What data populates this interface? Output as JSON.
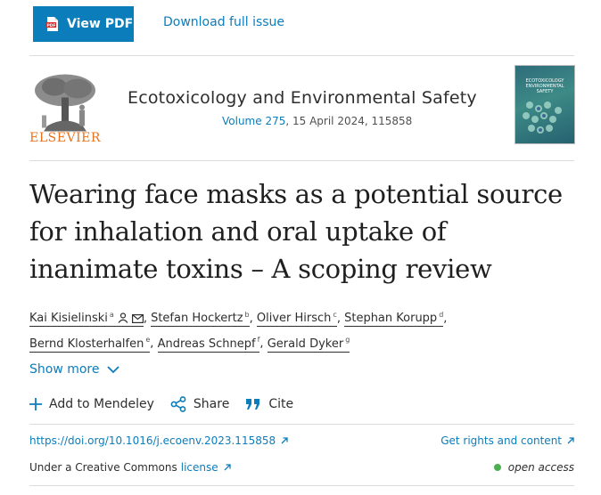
{
  "toolbar": {
    "view_pdf_label": "View PDF",
    "download_label": "Download full issue"
  },
  "journal": {
    "publisher": "ELSEVIER",
    "title": "Ecotoxicology and Environmental Safety",
    "volume_link": "Volume 275",
    "volume_rest": ", 15 April 2024, 115858",
    "cover_text": "ECOTOXICOLOGY ENVIRONMENTAL SAFETY"
  },
  "article": {
    "title": "Wearing face masks as a potential source for inhalation and oral uptake of inanimate toxins – A scoping review"
  },
  "authors": [
    {
      "name": "Kai Kisielinski",
      "sup": "a"
    },
    {
      "name": "Stefan Hockertz",
      "sup": "b"
    },
    {
      "name": "Oliver Hirsch",
      "sup": "c"
    },
    {
      "name": "Stephan Korupp",
      "sup": "d"
    },
    {
      "name": "Bernd Klosterhalfen",
      "sup": "e"
    },
    {
      "name": "Andreas Schnepf",
      "sup": "f"
    },
    {
      "name": "Gerald Dyker",
      "sup": "g"
    }
  ],
  "show_more_label": "Show more",
  "actions": {
    "mendeley": "Add to Mendeley",
    "share": "Share",
    "cite": "Cite"
  },
  "links": {
    "doi": "https://doi.org/10.1016/j.ecoenv.2023.115858",
    "rights": "Get rights and content",
    "license_prefix": "Under a Creative Commons",
    "license": "license",
    "open_access": "open access"
  },
  "colors": {
    "brand_blue": "#0c7dbb",
    "elsevier_orange": "#e9711c",
    "open_access_green": "#4caf50"
  }
}
